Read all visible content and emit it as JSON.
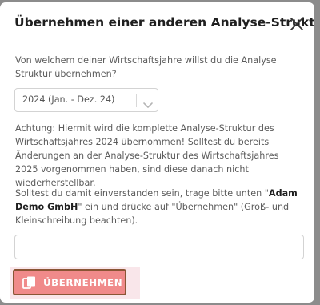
{
  "dialog": {
    "title": "Übernehmen einer anderen Analyse-Struktur",
    "close_icon": "close-icon"
  },
  "question": {
    "text": "Von welchem deiner Wirtschaftsjahre willst du die Analyse Struktur übernehmen?"
  },
  "year_select": {
    "selected": "2024 (Jan. - Dez. 24)",
    "chevron_icon": "chevron-down-icon"
  },
  "warning": {
    "text": "Achtung: Hiermit wird die komplette Analyse-Struktur des Wirtschaftsjahres 2024 übernommen! Solltest du bereits Änderungen an der Analyse-Struktur des Wirtschaftsjahres 2025 vorgenommen haben, sind diese danach nicht wiederherstellbar."
  },
  "confirm": {
    "prefix": "Solltest du damit einverstanden sein, trage bitte unten \"",
    "company": "Adam Demo GmbH",
    "suffix": "\" ein und drücke auf \"Übernehmen\" (Groß- und Kleinschreibung beachten)."
  },
  "name_input": {
    "value": "",
    "placeholder": ""
  },
  "submit": {
    "label": "ÜBERNEHMEN",
    "icon": "copy-icon",
    "color": "#f08a8a",
    "border_color": "#8a5535"
  }
}
